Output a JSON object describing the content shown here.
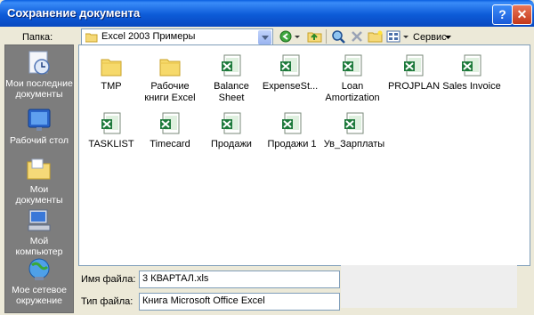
{
  "window": {
    "title": "Сохранение документа",
    "help_label": "?",
    "close_label": "✕"
  },
  "toolbar": {
    "folder_label": "Папка:",
    "folder_value": "Excel 2003 Примеры",
    "service_label": "Сервис",
    "icons": [
      "back-icon",
      "up-folder-icon",
      "search-web-icon",
      "delete-icon",
      "new-folder-icon",
      "views-icon"
    ]
  },
  "places": [
    {
      "label": "Мои последние документы",
      "icon": "recent-documents-icon"
    },
    {
      "label": "Рабочий стол",
      "icon": "desktop-icon"
    },
    {
      "label": "Мои документы",
      "icon": "my-documents-icon"
    },
    {
      "label": "Мой компьютер",
      "icon": "my-computer-icon"
    },
    {
      "label": "Мое сетевое окружение",
      "icon": "network-places-icon"
    }
  ],
  "files": [
    {
      "name": "TMP",
      "type": "folder"
    },
    {
      "name": "Рабочие книги Excel",
      "type": "folder"
    },
    {
      "name": "Balance Sheet",
      "type": "excel"
    },
    {
      "name": "ExpenseSt...",
      "type": "excel"
    },
    {
      "name": "Loan Amortization",
      "type": "excel"
    },
    {
      "name": "PROJPLAN",
      "type": "excel"
    },
    {
      "name": "Sales Invoice",
      "type": "excel"
    },
    {
      "name": "TASKLIST",
      "type": "excel"
    },
    {
      "name": "Timecard",
      "type": "excel"
    },
    {
      "name": "Продажи",
      "type": "excel"
    },
    {
      "name": "Продажи 1",
      "type": "excel"
    },
    {
      "name": "Ув_Зарплаты",
      "type": "excel"
    }
  ],
  "filename": {
    "label": "Имя файла:",
    "value": "3 КВАРТАЛ.xls"
  },
  "filetype": {
    "label": "Тип файла:",
    "value": "Книга Microsoft Office Excel"
  },
  "colors": {
    "titlebar": "#0a5fe0",
    "dialog": "#ece9d8",
    "places_bar": "#7d7d7d",
    "excel_green": "#1e7a3c"
  }
}
